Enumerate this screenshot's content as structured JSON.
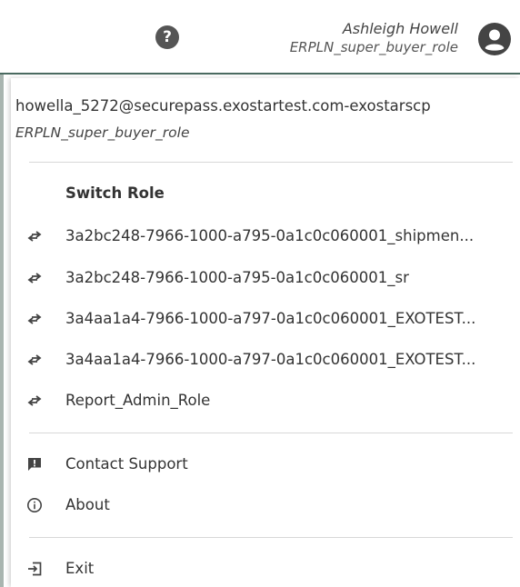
{
  "header": {
    "user_name": "Ashleigh Howell",
    "user_role": "ERPLN_super_buyer_role",
    "help_glyph": "?"
  },
  "menu": {
    "email": "howella_5272@securepass.exostartest.com-exostarscp",
    "role": "ERPLN_super_buyer_role",
    "switch_role_title": "Switch Role",
    "roles": [
      "3a2bc248-7966-1000-a795-0a1c0c060001_shipmen...",
      "3a2bc248-7966-1000-a795-0a1c0c060001_sr",
      "3a4aa1a4-7966-1000-a797-0a1c0c060001_EXOTEST...",
      "3a4aa1a4-7966-1000-a797-0a1c0c060001_EXOTEST...",
      "Report_Admin_Role"
    ],
    "contact_support": "Contact Support",
    "about": "About",
    "exit": "Exit"
  },
  "colors": {
    "header_border": "#4a6a60",
    "icon": "#444444",
    "text": "#333333"
  }
}
